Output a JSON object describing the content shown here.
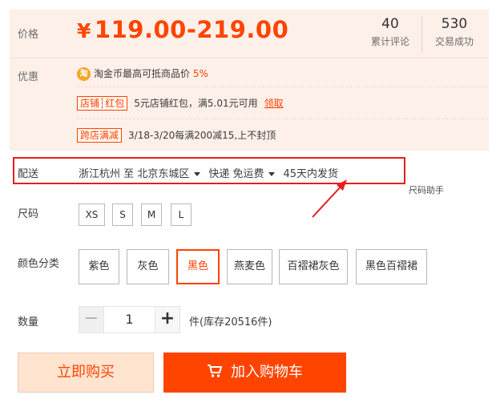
{
  "price_panel": {
    "price_label": "价格",
    "currency_symbol": "¥",
    "price_range": "119.00-219.00",
    "reviews": {
      "count": "40",
      "label": "累计评论"
    },
    "sales": {
      "count": "530",
      "label": "交易成功"
    }
  },
  "promotions": {
    "label": "优惠",
    "coin_icon_text": "淘",
    "line1_text": "淘金币最高可抵商品价",
    "line1_highlight": "5%",
    "shop_tag": "店铺┆红包",
    "line2_text": "5元店铺红包，满5.01元可用",
    "line2_link": "领取",
    "cross_tag": "跨店满减",
    "line3_text": "3/18-3/20每满200减15,上不封顶"
  },
  "delivery": {
    "label": "配送",
    "from": "浙江杭州",
    "to_word": "至",
    "destination": "北京东城区",
    "shipping": "快递 免运费",
    "ship_time": "45天内发货",
    "size_helper": "尺码助手"
  },
  "sizes": {
    "label": "尺码",
    "options": [
      "XS",
      "S",
      "M",
      "L"
    ]
  },
  "colors": {
    "label": "颜色分类",
    "options": [
      "紫色",
      "灰色",
      "黑色",
      "燕麦色",
      "百褶裙灰色",
      "黑色百褶裙"
    ],
    "selected": "黑色"
  },
  "quantity": {
    "label": "数量",
    "minus": "−",
    "value": "1",
    "plus": "+",
    "stock_text": "件(库存20516件)"
  },
  "actions": {
    "buy_now": "立即购买",
    "add_to_cart": "加入购物车"
  },
  "colors_theme": {
    "accent": "#ff4400",
    "panel_bg": "#fdf0e9",
    "highlight_border": "#e41e1e"
  }
}
